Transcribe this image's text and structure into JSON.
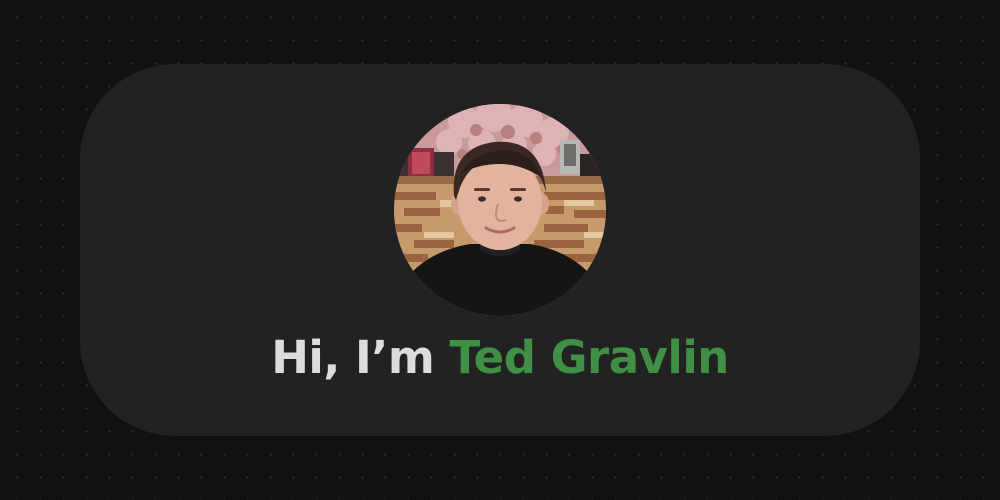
{
  "hero": {
    "greeting_prefix": "Hi, I’m ",
    "name": "Ted Gravlin"
  },
  "avatar": {
    "kind": "profile-photo"
  },
  "colors": {
    "page_background": "#111111",
    "card_background": "#222222",
    "greeting_text": "#dcdcdc",
    "name_accent": "#3f8f45"
  }
}
